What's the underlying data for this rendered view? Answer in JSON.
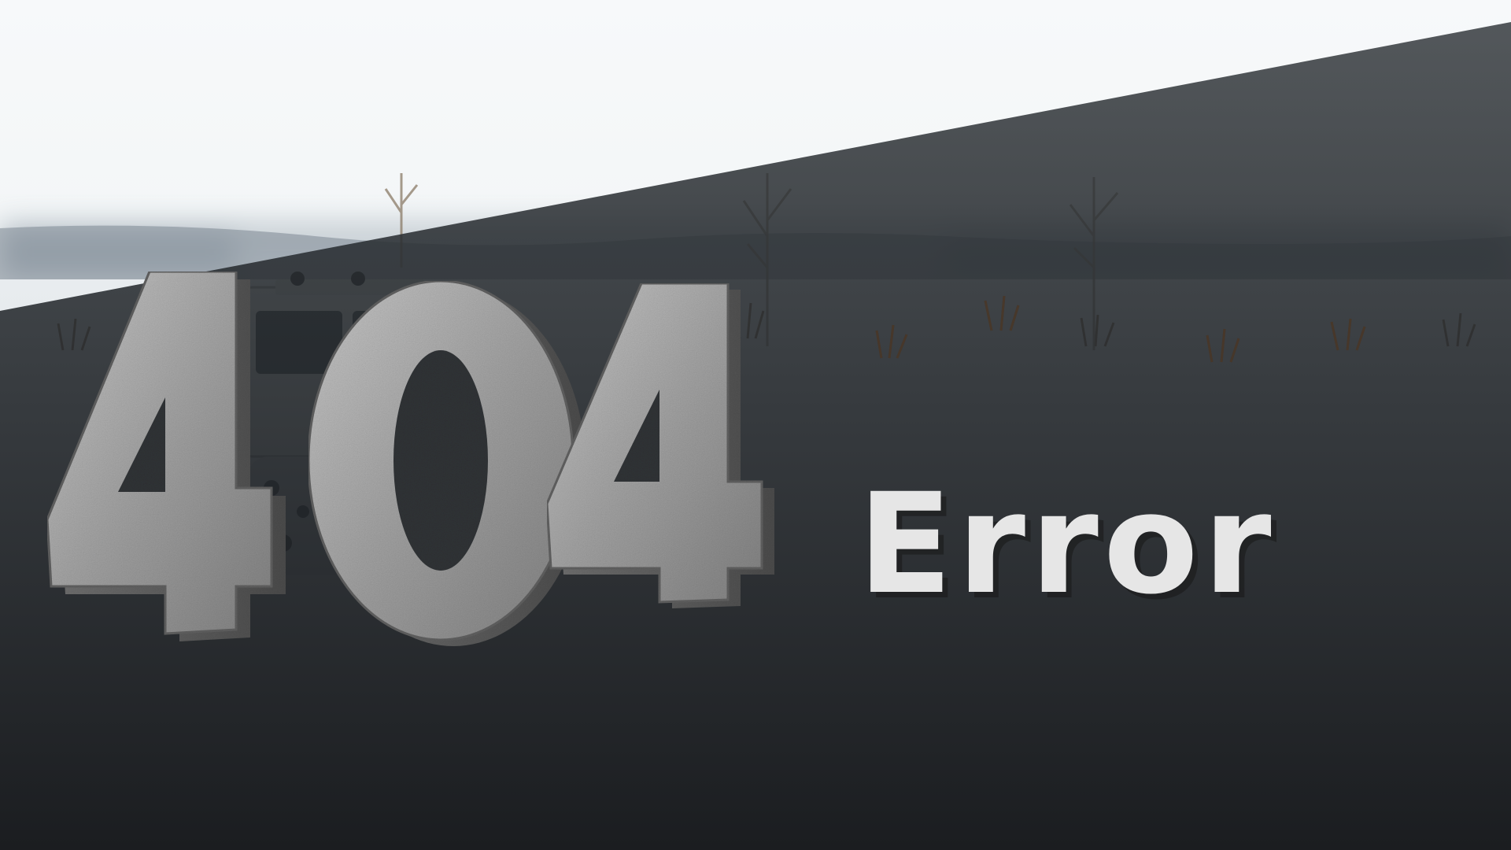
{
  "error": {
    "code": "404",
    "word": "Error"
  },
  "colors": {
    "sky": "#f4f7f8",
    "dark_overlay": "#1e2023",
    "stone": "#9a9a9a",
    "error_text": "#e6e6e6"
  },
  "icons": {
    "vehicle": "snow-vehicle-image"
  }
}
